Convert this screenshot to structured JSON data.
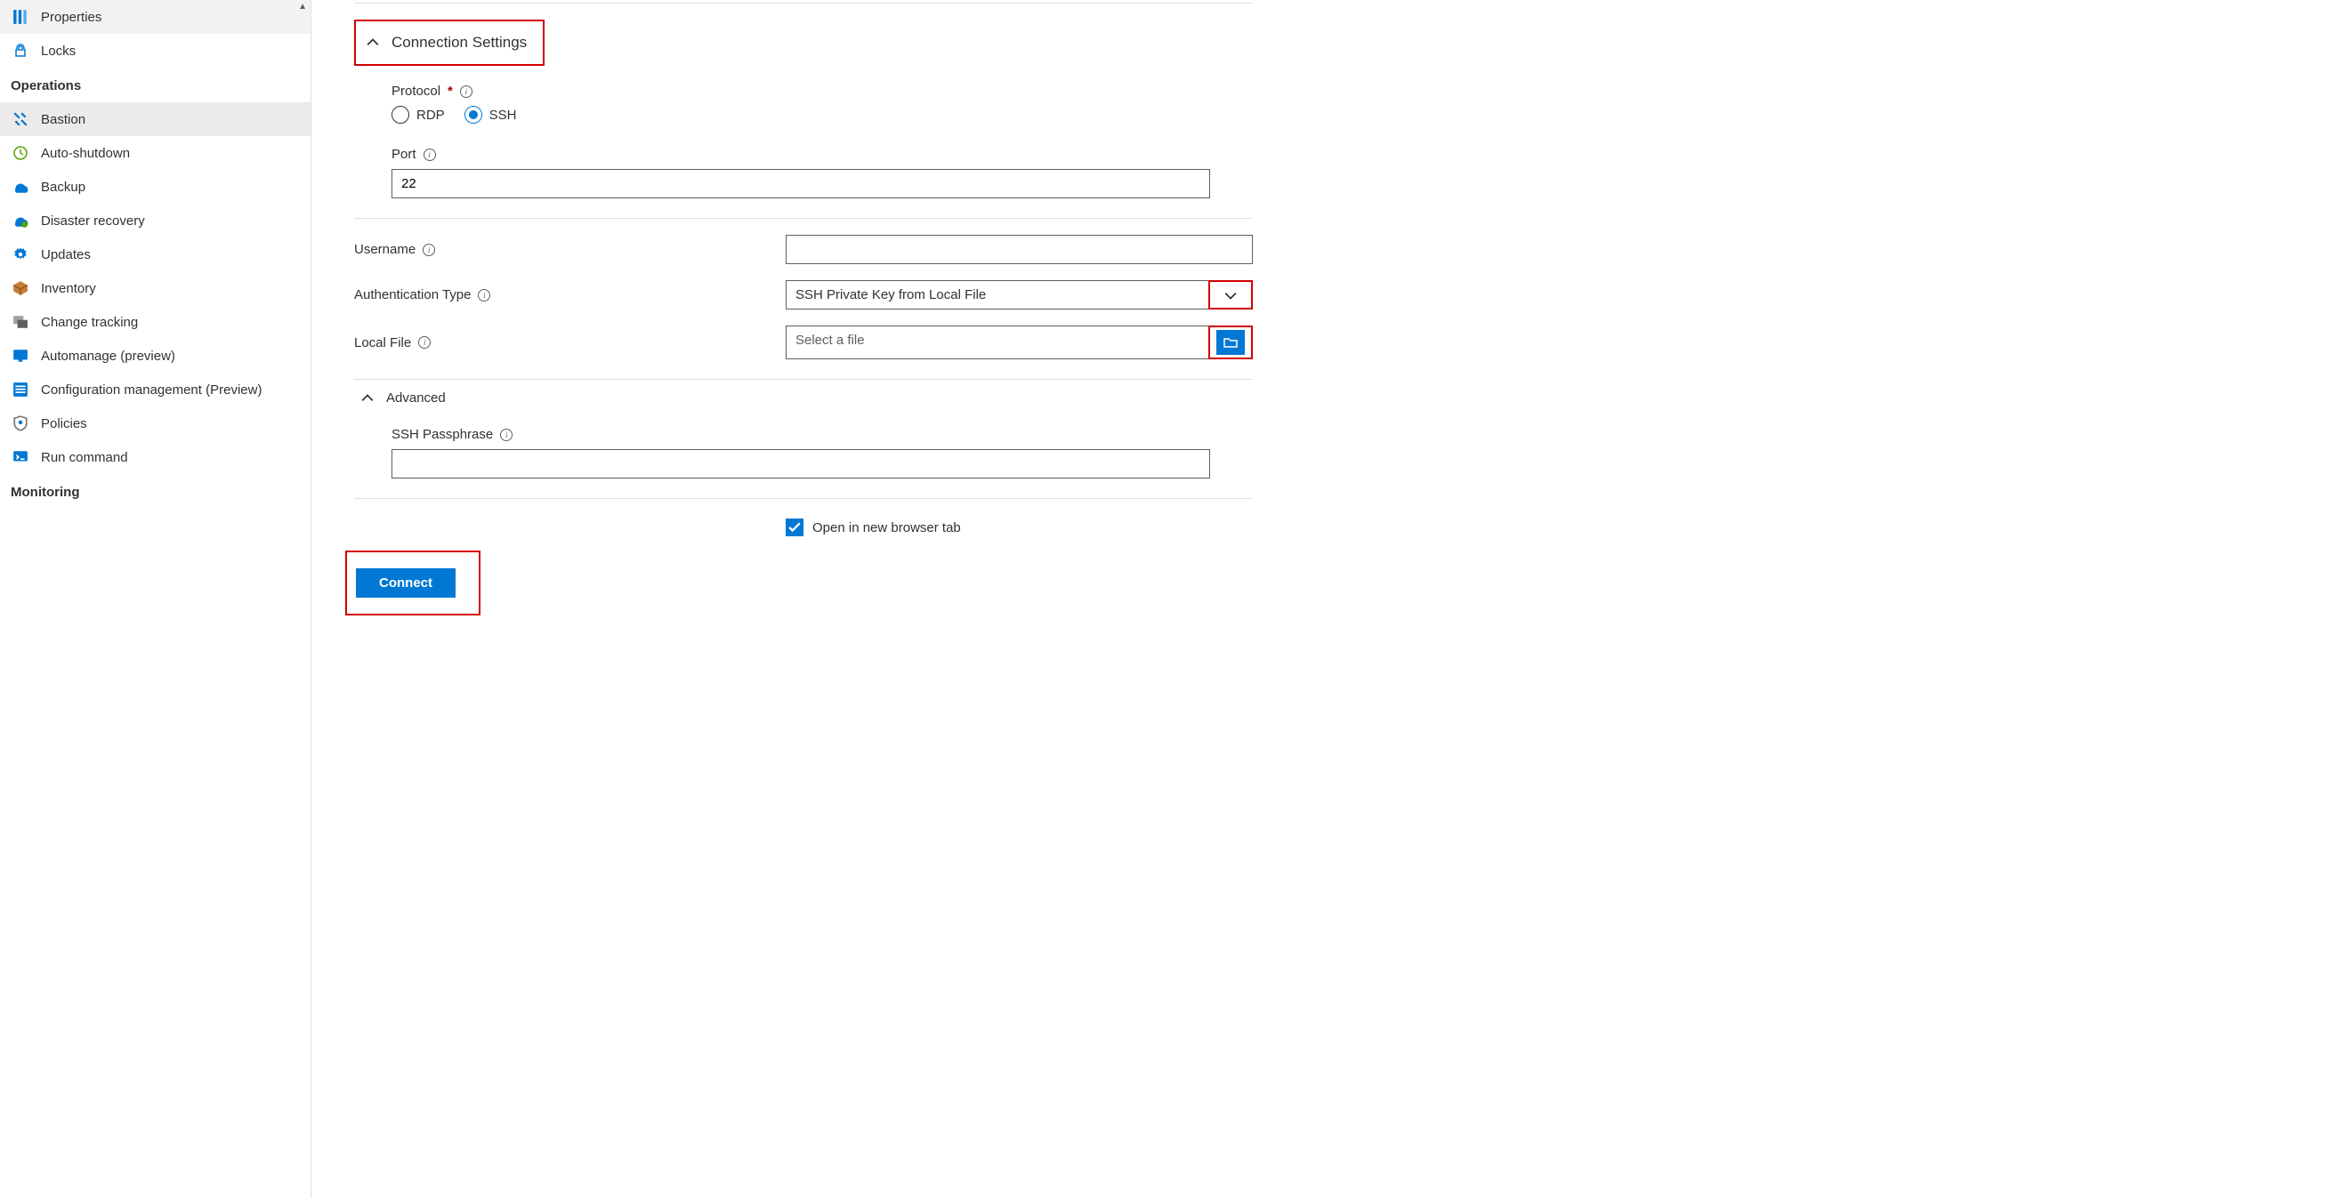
{
  "sidebar": {
    "properties": "Properties",
    "locks": "Locks",
    "section_operations": "Operations",
    "bastion": "Bastion",
    "auto_shutdown": "Auto-shutdown",
    "backup": "Backup",
    "disaster_recovery": "Disaster recovery",
    "updates": "Updates",
    "inventory": "Inventory",
    "change_tracking": "Change tracking",
    "automanage": "Automanage (preview)",
    "config_mgmt": "Configuration management (Preview)",
    "policies": "Policies",
    "run_command": "Run command",
    "section_monitoring": "Monitoring"
  },
  "main": {
    "connection_settings": "Connection Settings",
    "protocol_label": "Protocol",
    "protocol_rdp": "RDP",
    "protocol_ssh": "SSH",
    "port_label": "Port",
    "port_value": "22",
    "username_label": "Username",
    "username_value": "",
    "auth_type_label": "Authentication Type",
    "auth_type_value": "SSH Private Key from Local File",
    "local_file_label": "Local File",
    "local_file_placeholder": "Select a file",
    "advanced_title": "Advanced",
    "ssh_passphrase_label": "SSH Passphrase",
    "ssh_passphrase_value": "",
    "open_new_tab_label": "Open in new browser tab",
    "connect_button": "Connect"
  }
}
